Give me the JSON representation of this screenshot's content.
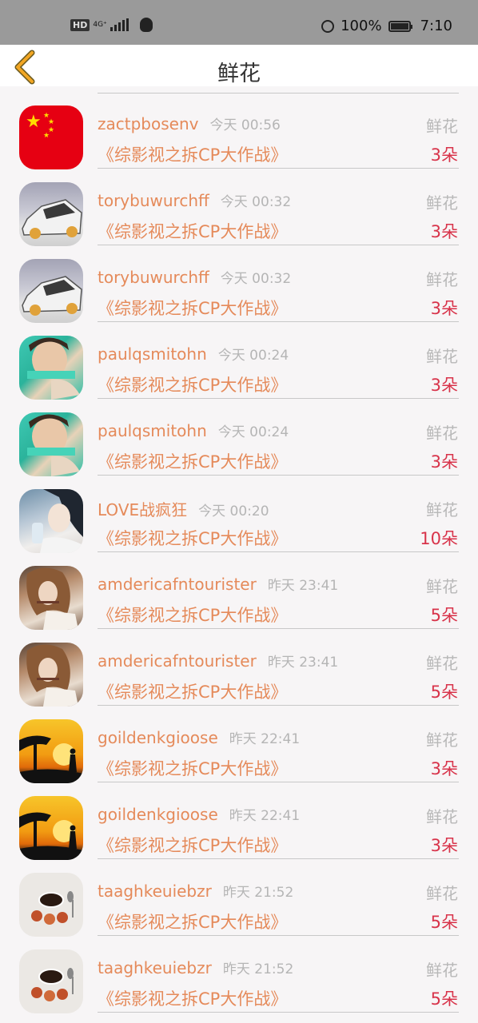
{
  "status_bar": {
    "hd": "HD",
    "network": "4G⁺",
    "battery": "100%",
    "battery_level": 1.0,
    "time": "7:10",
    "icons": [
      "hd-icon",
      "signal-icon",
      "qq-icon",
      "alarm-icon",
      "battery-icon"
    ]
  },
  "nav": {
    "title": "鲜花",
    "back_icon": "chevron-left-icon",
    "accent": "#f2a623"
  },
  "colors": {
    "name": "#e58a5a",
    "time": "#b5b5b5",
    "tag": "#b8b8b8",
    "count": "#d8334a"
  },
  "items": [
    {
      "user": "zactpbosenv",
      "time": "今天 00:56",
      "tag": "鲜花",
      "show": "《综影视之拆CP大作战》",
      "count": "3朵",
      "avatar": "flag"
    },
    {
      "user": "torybuwurchff",
      "time": "今天 00:32",
      "tag": "鲜花",
      "show": "《综影视之拆CP大作战》",
      "count": "3朵",
      "avatar": "car"
    },
    {
      "user": "torybuwurchff",
      "time": "今天 00:32",
      "tag": "鲜花",
      "show": "《综影视之拆CP大作战》",
      "count": "3朵",
      "avatar": "car"
    },
    {
      "user": "paulqsmitohn",
      "time": "今天 00:24",
      "tag": "鲜花",
      "show": "《综影视之拆CP大作战》",
      "count": "3朵",
      "avatar": "boy"
    },
    {
      "user": "paulqsmitohn",
      "time": "今天 00:24",
      "tag": "鲜花",
      "show": "《综影视之拆CP大作战》",
      "count": "3朵",
      "avatar": "boy"
    },
    {
      "user": "LOVE战疯狂",
      "time": "今天 00:20",
      "tag": "鲜花",
      "show": "《综影视之拆CP大作战》",
      "count": "10朵",
      "avatar": "girl"
    },
    {
      "user": "amdericafntourister",
      "time": "昨天 23:41",
      "tag": "鲜花",
      "show": "《综影视之拆CP大作战》",
      "count": "5朵",
      "avatar": "smoke"
    },
    {
      "user": "amdericafntourister",
      "time": "昨天 23:41",
      "tag": "鲜花",
      "show": "《综影视之拆CP大作战》",
      "count": "5朵",
      "avatar": "smoke"
    },
    {
      "user": "goildenkgioose",
      "time": "昨天 22:41",
      "tag": "鲜花",
      "show": "《综影视之拆CP大作战》",
      "count": "3朵",
      "avatar": "sunset"
    },
    {
      "user": "goildenkgioose",
      "time": "昨天 22:41",
      "tag": "鲜花",
      "show": "《综影视之拆CP大作战》",
      "count": "3朵",
      "avatar": "sunset"
    },
    {
      "user": "taaghkeuiebzr",
      "time": "昨天 21:52",
      "tag": "鲜花",
      "show": "《综影视之拆CP大作战》",
      "count": "5朵",
      "avatar": "coffee"
    },
    {
      "user": "taaghkeuiebzr",
      "time": "昨天 21:52",
      "tag": "鲜花",
      "show": "《综影视之拆CP大作战》",
      "count": "5朵",
      "avatar": "coffee"
    }
  ]
}
